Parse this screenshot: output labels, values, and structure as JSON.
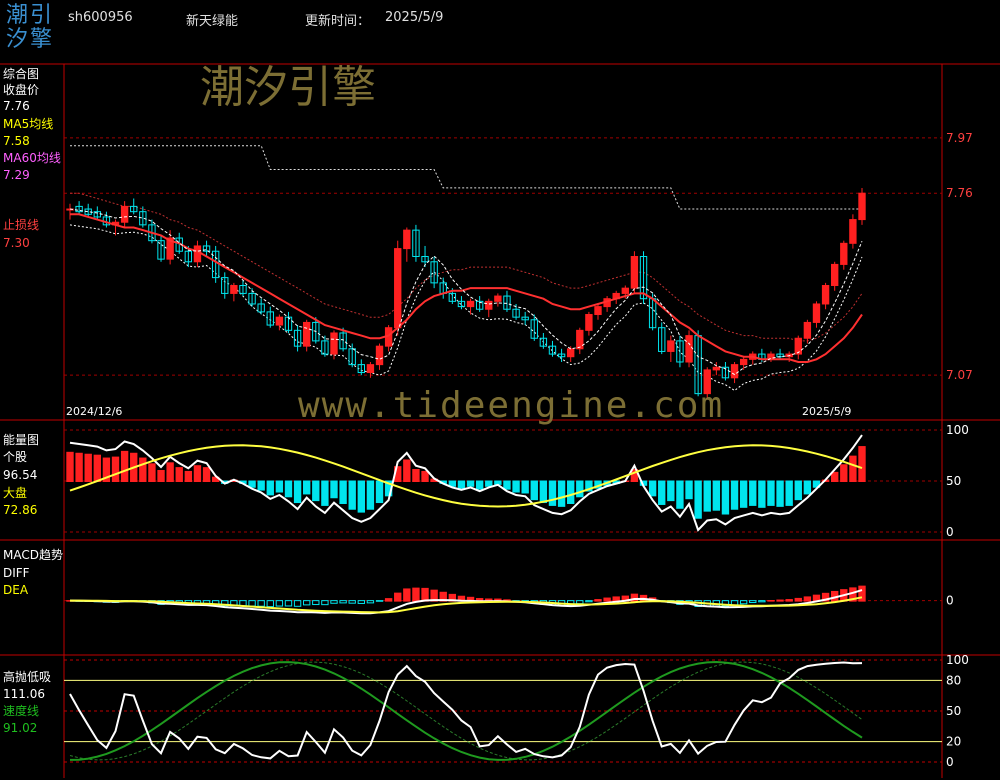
{
  "header": {
    "logo_text_1": "潮引",
    "logo_text_2": "汐擎",
    "code": "sh600956",
    "name": "新天绿能",
    "update_label": "更新时间：",
    "update_date": "2025/5/9"
  },
  "watermark": {
    "brand": "潮汐引擎",
    "url": "www.tideengine.com"
  },
  "colors": {
    "up": "#ff2020",
    "down": "#00e5ee",
    "ma5": "#ffffff",
    "ma60": "#ff3030",
    "stop": "#dddddd",
    "yellow": "#ffff40",
    "green": "#1f9a1f",
    "grid": "#a00000",
    "label_red": "#ff4040",
    "label_white": "#ffffff",
    "label_yellow": "#ffff00",
    "label_pink": "#ff60ff"
  },
  "panels": {
    "main": {
      "title": "综合图",
      "close_label": "收盘价",
      "close_value": "7.76",
      "ma5_label": "MA5均线",
      "ma5_value": "7.58",
      "ma60_label": "MA60均线",
      "ma60_value": "7.29",
      "stop_label": "止损线",
      "stop_value": "7.30",
      "start_date": "2024/12/6",
      "end_date": "2025/5/9"
    },
    "energy": {
      "title": "能量图",
      "stock_label": "个股",
      "stock_value": "96.54",
      "market_label": "大盘",
      "market_value": "72.86"
    },
    "macd": {
      "title": "MACD趋势",
      "diff_label": "DIFF",
      "dea_label": "DEA"
    },
    "kdj": {
      "title": "高抛低吸",
      "value": "111.06",
      "speed_label": "速度线",
      "speed_value": "91.02"
    }
  },
  "chart_data": [
    {
      "type": "candlestick",
      "panel": "综合图",
      "y_ticks": [
        "7.97",
        "7.76",
        "7.07"
      ],
      "y_tick_values": [
        7.97,
        7.76,
        7.07
      ],
      "ylim": [
        6.9,
        8.25
      ],
      "candles": [
        [
          7.7,
          7.72,
          7.66,
          7.7
        ],
        [
          7.71,
          7.73,
          7.68,
          7.69
        ],
        [
          7.7,
          7.72,
          7.67,
          7.68
        ],
        [
          7.69,
          7.71,
          7.66,
          7.67
        ],
        [
          7.67,
          7.69,
          7.63,
          7.64
        ],
        [
          7.64,
          7.66,
          7.6,
          7.65
        ],
        [
          7.65,
          7.73,
          7.63,
          7.71
        ],
        [
          7.71,
          7.74,
          7.68,
          7.69
        ],
        [
          7.69,
          7.71,
          7.63,
          7.64
        ],
        [
          7.64,
          7.66,
          7.57,
          7.58
        ],
        [
          7.58,
          7.6,
          7.5,
          7.51
        ],
        [
          7.51,
          7.62,
          7.49,
          7.59
        ],
        [
          7.59,
          7.61,
          7.53,
          7.54
        ],
        [
          7.54,
          7.56,
          7.48,
          7.5
        ],
        [
          7.5,
          7.58,
          7.48,
          7.56
        ],
        [
          7.56,
          7.58,
          7.52,
          7.54
        ],
        [
          7.54,
          7.56,
          7.42,
          7.44
        ],
        [
          7.44,
          7.46,
          7.36,
          7.38
        ],
        [
          7.38,
          7.42,
          7.35,
          7.41
        ],
        [
          7.41,
          7.43,
          7.37,
          7.38
        ],
        [
          7.38,
          7.4,
          7.33,
          7.34
        ],
        [
          7.34,
          7.36,
          7.3,
          7.31
        ],
        [
          7.31,
          7.33,
          7.25,
          7.26
        ],
        [
          7.26,
          7.3,
          7.24,
          7.29
        ],
        [
          7.29,
          7.31,
          7.23,
          7.24
        ],
        [
          7.24,
          7.26,
          7.16,
          7.18
        ],
        [
          7.18,
          7.28,
          7.16,
          7.27
        ],
        [
          7.27,
          7.29,
          7.19,
          7.2
        ],
        [
          7.2,
          7.22,
          7.14,
          7.15
        ],
        [
          7.15,
          7.24,
          7.13,
          7.23
        ],
        [
          7.23,
          7.25,
          7.16,
          7.17
        ],
        [
          7.17,
          7.19,
          7.1,
          7.11
        ],
        [
          7.11,
          7.13,
          7.07,
          7.08
        ],
        [
          7.08,
          7.12,
          7.06,
          7.11
        ],
        [
          7.11,
          7.19,
          7.09,
          7.18
        ],
        [
          7.18,
          7.26,
          7.16,
          7.25
        ],
        [
          7.25,
          7.58,
          7.22,
          7.55
        ],
        [
          7.55,
          7.63,
          7.5,
          7.62
        ],
        [
          7.62,
          7.64,
          7.5,
          7.52
        ],
        [
          7.52,
          7.56,
          7.48,
          7.5
        ],
        [
          7.5,
          7.52,
          7.4,
          7.42
        ],
        [
          7.42,
          7.44,
          7.36,
          7.38
        ],
        [
          7.38,
          7.4,
          7.34,
          7.35
        ],
        [
          7.35,
          7.37,
          7.32,
          7.33
        ],
        [
          7.33,
          7.36,
          7.3,
          7.35
        ],
        [
          7.35,
          7.37,
          7.31,
          7.32
        ],
        [
          7.32,
          7.36,
          7.29,
          7.35
        ],
        [
          7.35,
          7.38,
          7.33,
          7.37
        ],
        [
          7.37,
          7.39,
          7.31,
          7.32
        ],
        [
          7.32,
          7.34,
          7.28,
          7.29
        ],
        [
          7.29,
          7.31,
          7.26,
          7.28
        ],
        [
          7.28,
          7.3,
          7.2,
          7.21
        ],
        [
          7.21,
          7.23,
          7.17,
          7.18
        ],
        [
          7.18,
          7.2,
          7.14,
          7.15
        ],
        [
          7.15,
          7.17,
          7.12,
          7.14
        ],
        [
          7.14,
          7.18,
          7.12,
          7.17
        ],
        [
          7.17,
          7.25,
          7.15,
          7.24
        ],
        [
          7.24,
          7.31,
          7.22,
          7.3
        ],
        [
          7.3,
          7.34,
          7.28,
          7.33
        ],
        [
          7.33,
          7.37,
          7.31,
          7.36
        ],
        [
          7.36,
          7.39,
          7.34,
          7.38
        ],
        [
          7.38,
          7.41,
          7.36,
          7.4
        ],
        [
          7.4,
          7.54,
          7.38,
          7.52
        ],
        [
          7.52,
          7.54,
          7.34,
          7.36
        ],
        [
          7.36,
          7.38,
          7.24,
          7.25
        ],
        [
          7.25,
          7.27,
          7.15,
          7.16
        ],
        [
          7.16,
          7.22,
          7.12,
          7.2
        ],
        [
          7.2,
          7.22,
          7.1,
          7.12
        ],
        [
          7.12,
          7.24,
          7.1,
          7.22
        ],
        [
          7.22,
          7.24,
          6.99,
          7.0
        ],
        [
          7.0,
          7.1,
          6.98,
          7.09
        ],
        [
          7.09,
          7.12,
          7.07,
          7.1
        ],
        [
          7.1,
          7.12,
          7.05,
          7.06
        ],
        [
          7.06,
          7.12,
          7.04,
          7.11
        ],
        [
          7.11,
          7.14,
          7.09,
          7.13
        ],
        [
          7.13,
          7.16,
          7.11,
          7.15
        ],
        [
          7.15,
          7.17,
          7.12,
          7.13
        ],
        [
          7.13,
          7.16,
          7.12,
          7.15
        ],
        [
          7.15,
          7.17,
          7.13,
          7.14
        ],
        [
          7.14,
          7.16,
          7.12,
          7.15
        ],
        [
          7.15,
          7.22,
          7.13,
          7.21
        ],
        [
          7.21,
          7.28,
          7.19,
          7.27
        ],
        [
          7.27,
          7.35,
          7.25,
          7.34
        ],
        [
          7.34,
          7.42,
          7.32,
          7.41
        ],
        [
          7.41,
          7.5,
          7.39,
          7.49
        ],
        [
          7.49,
          7.58,
          7.47,
          7.57
        ],
        [
          7.57,
          7.68,
          7.55,
          7.66
        ],
        [
          7.66,
          7.78,
          7.64,
          7.76
        ]
      ],
      "ma60": [
        7.68,
        7.68,
        7.67,
        7.66,
        7.65,
        7.64,
        7.63,
        7.63,
        7.62,
        7.61,
        7.6,
        7.58,
        7.57,
        7.55,
        7.54,
        7.52,
        7.5,
        7.48,
        7.46,
        7.44,
        7.42,
        7.4,
        7.38,
        7.36,
        7.34,
        7.32,
        7.3,
        7.28,
        7.26,
        7.25,
        7.24,
        7.23,
        7.22,
        7.21,
        7.21,
        7.22,
        7.25,
        7.28,
        7.32,
        7.35,
        7.37,
        7.38,
        7.39,
        7.39,
        7.4,
        7.4,
        7.4,
        7.4,
        7.4,
        7.39,
        7.38,
        7.37,
        7.36,
        7.34,
        7.33,
        7.32,
        7.32,
        7.33,
        7.34,
        7.35,
        7.36,
        7.37,
        7.38,
        7.38,
        7.36,
        7.33,
        7.3,
        7.27,
        7.25,
        7.22,
        7.2,
        7.18,
        7.16,
        7.15,
        7.14,
        7.14,
        7.13,
        7.13,
        7.13,
        7.13,
        7.12,
        7.12,
        7.13,
        7.15,
        7.18,
        7.21,
        7.25,
        7.3
      ],
      "stop_line": [
        7.94,
        7.94,
        7.94,
        7.94,
        7.94,
        7.94,
        7.94,
        7.94,
        7.94,
        7.94,
        7.94,
        7.94,
        7.94,
        7.94,
        7.94,
        7.94,
        7.94,
        7.94,
        7.94,
        7.94,
        7.94,
        7.94,
        7.85,
        7.85,
        7.85,
        7.85,
        7.85,
        7.85,
        7.85,
        7.85,
        7.85,
        7.85,
        7.85,
        7.85,
        7.85,
        7.85,
        7.85,
        7.85,
        7.85,
        7.85,
        7.85,
        7.78,
        7.78,
        7.78,
        7.78,
        7.78,
        7.78,
        7.78,
        7.78,
        7.78,
        7.78,
        7.78,
        7.78,
        7.78,
        7.78,
        7.78,
        7.78,
        7.78,
        7.78,
        7.78,
        7.78,
        7.78,
        7.78,
        7.78,
        7.78,
        7.78,
        7.78,
        7.7,
        7.7,
        7.7,
        7.7,
        7.7,
        7.7,
        7.7,
        7.7,
        7.7,
        7.7,
        7.7,
        7.7,
        7.7,
        7.7,
        7.7,
        7.7,
        7.7,
        7.7,
        7.7,
        7.7,
        7.7
      ]
    },
    {
      "type": "bar-line",
      "panel": "能量图",
      "y_ticks": [
        "100",
        "50",
        "0"
      ],
      "y_tick_values": [
        100,
        50,
        0
      ],
      "ylim": [
        0,
        100
      ]
    },
    {
      "type": "bar-line",
      "panel": "MACD趋势",
      "y_ticks": [
        "0"
      ],
      "y_tick_values": [
        0
      ],
      "ylim": [
        -0.45,
        0.5
      ]
    },
    {
      "type": "line",
      "panel": "高抛低吸",
      "y_ticks": [
        "100",
        "80",
        "50",
        "20",
        "0"
      ],
      "y_tick_values": [
        100,
        80,
        50,
        20,
        0
      ],
      "ylim": [
        0,
        100
      ]
    }
  ]
}
